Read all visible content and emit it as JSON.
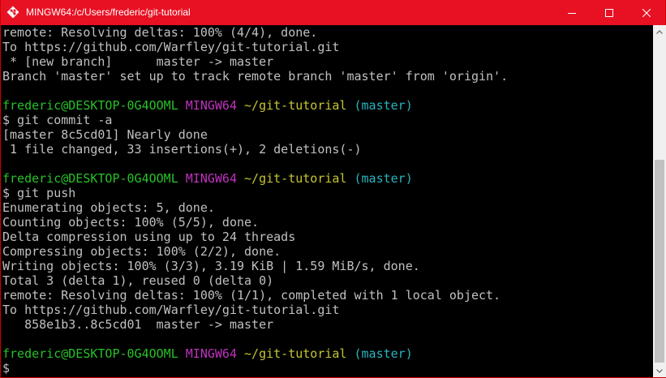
{
  "window": {
    "title": "MINGW64:/c/Users/frederic/git-tutorial",
    "accent_color": "#e81123",
    "icons": {
      "app": "git-bash-icon",
      "minimize": "minimize-icon",
      "maximize": "maximize-icon",
      "close": "close-icon"
    }
  },
  "prompt": {
    "user_host": "frederic@DESKTOP-0G4OOML",
    "shell": "MINGW64",
    "path": "~/git-tutorial",
    "branch": "(master)",
    "symbol": "$"
  },
  "terminal": {
    "lines_top": [
      "remote: Resolving deltas: 100% (4/4), done.",
      "To https://github.com/Warfley/git-tutorial.git",
      " * [new branch]      master -> master",
      "Branch 'master' set up to track remote branch 'master' from 'origin'."
    ],
    "commit_command": "$ git commit -a",
    "commit_output": [
      "[master 8c5cd01] Nearly done",
      " 1 file changed, 33 insertions(+), 2 deletions(-)"
    ],
    "push_command": "$ git push",
    "push_output": [
      "Enumerating objects: 5, done.",
      "Counting objects: 100% (5/5), done.",
      "Delta compression using up to 24 threads",
      "Compressing objects: 100% (2/2), done.",
      "Writing objects: 100% (3/3), 3.19 KiB | 1.59 MiB/s, done.",
      "Total 3 (delta 1), reused 0 (delta 0)",
      "remote: Resolving deltas: 100% (1/1), completed with 1 local object.",
      "To https://github.com/Warfley/git-tutorial.git",
      "   858e1b3..8c5cd01  master -> master"
    ],
    "colors": {
      "text": "#c0c0c0",
      "user_host": "#27c227",
      "shell": "#c032c0",
      "path": "#c5c532",
      "branch": "#2bb3c0"
    }
  }
}
